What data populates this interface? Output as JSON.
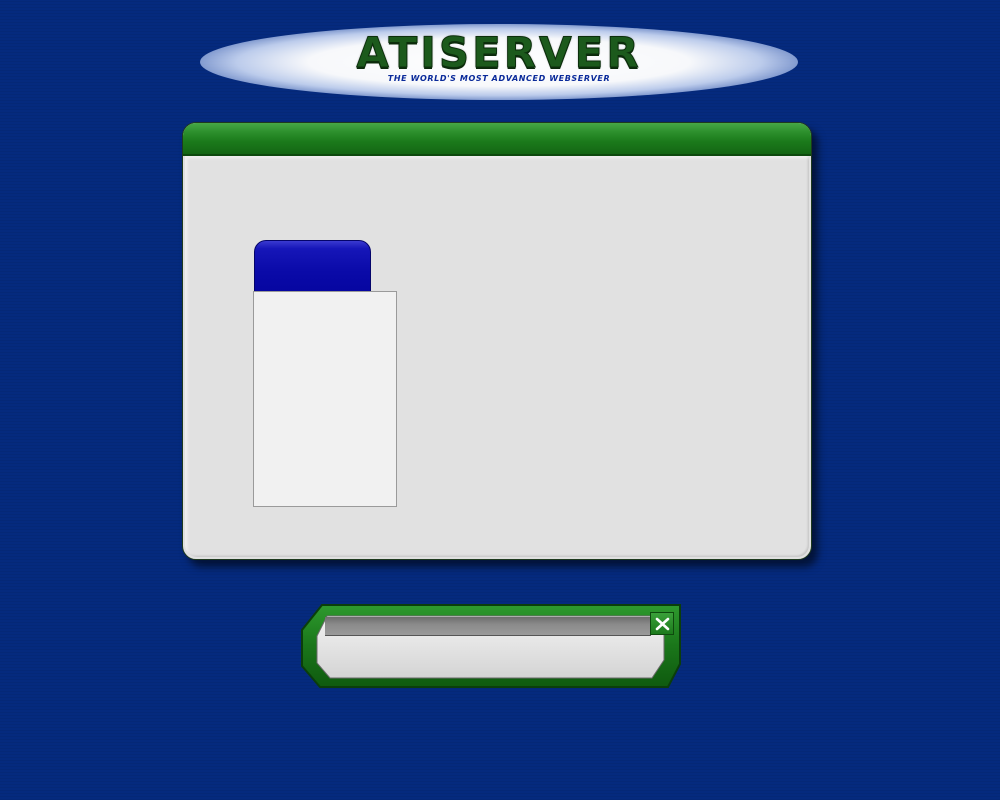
{
  "logo": {
    "title": "ATISERVER",
    "tagline": "THE WORLD'S MOST ADVANCED WEBSERVER"
  },
  "icons": {
    "close": "close-icon"
  },
  "colors": {
    "background": "#052a7e",
    "titlebar_green": "#1b7a1b",
    "tab_blue": "#0a0aa8",
    "window_gray": "#e0e0e0",
    "panel_white": "#f1f1f1"
  }
}
